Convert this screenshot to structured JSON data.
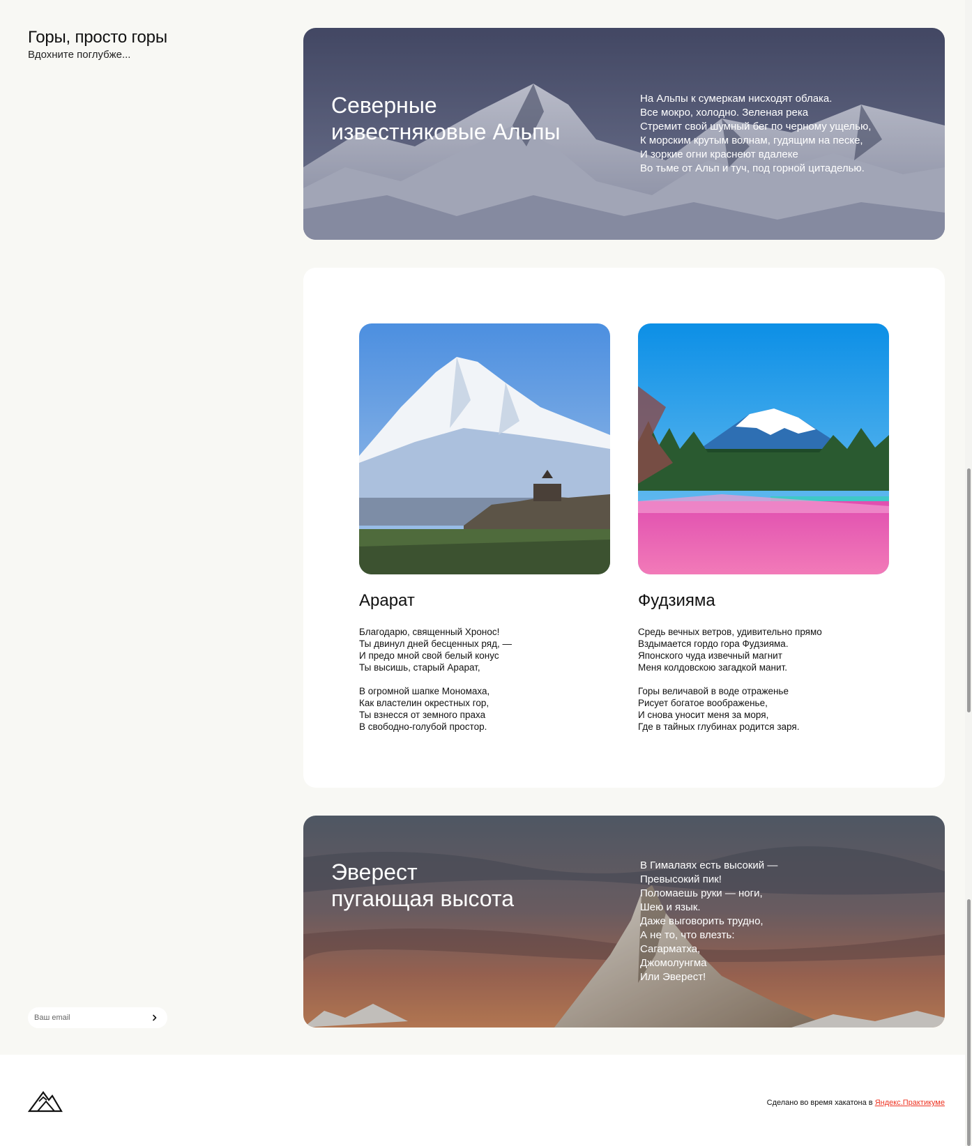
{
  "aside": {
    "title": "Горы, просто горы",
    "subtitle": "Вдохните поглубже..."
  },
  "subscribe": {
    "placeholder": "Ваш email",
    "submit_icon": "chevron-right-icon"
  },
  "alps": {
    "title": "Северные\nизвестняковые Альпы",
    "poem": [
      "На Альпы к сумеркам нисходят облака.",
      "Все мокро, холодно. Зеленая река",
      "Стремит свой шумный бег по черному ущелью,",
      "К морским крутым волнам, гудящим на песке,",
      "И зоркие огни краснеют вдалеке",
      "Во тьме от Альп и туч, под горной цитаделью."
    ]
  },
  "ararat": {
    "name": "Арарат",
    "stanzas": [
      [
        "Благодарю, священный Хронос!",
        "Ты двинул дней бесценных ряд, —",
        "И предо мной свой белый конус",
        "Ты высишь, старый Арарат,"
      ],
      [
        "В огромной шапке Мономаха,",
        "Как властелин окрестных гор,",
        "Ты взнесся от земного праха",
        "В свободно-голубой простор."
      ]
    ]
  },
  "fuji": {
    "name": "Фудзияма",
    "stanzas": [
      [
        "Средь вечных ветров, удивительно прямо",
        "Вздымается гордо гора Фудзияма.",
        "Японского чуда извечный магнит",
        "Меня колдовскою загадкой манит."
      ],
      [
        "Горы величавой в воде отраженье",
        "Рисует богатое воображенье,",
        "И снова уносит меня за моря,",
        "Где в тайных глубинах родится заря."
      ]
    ]
  },
  "everest": {
    "title": "Эверест\nпугающая высота",
    "poem": [
      "В Гималаях есть высокий —",
      "Превысокий пик!",
      "Поломаешь руки — ноги,",
      "Шею и язык.",
      "Даже выговорить трудно,",
      "А не то, что влезть:",
      "Сагарматха,",
      "Джомолунгма",
      "Или Эверест!"
    ]
  },
  "footer": {
    "text": "Сделано во время хакатона в ",
    "link_text": "Яндекс.Практикуме",
    "logo_icon": "mountain-logo-icon",
    "link_color": "#e32222"
  }
}
